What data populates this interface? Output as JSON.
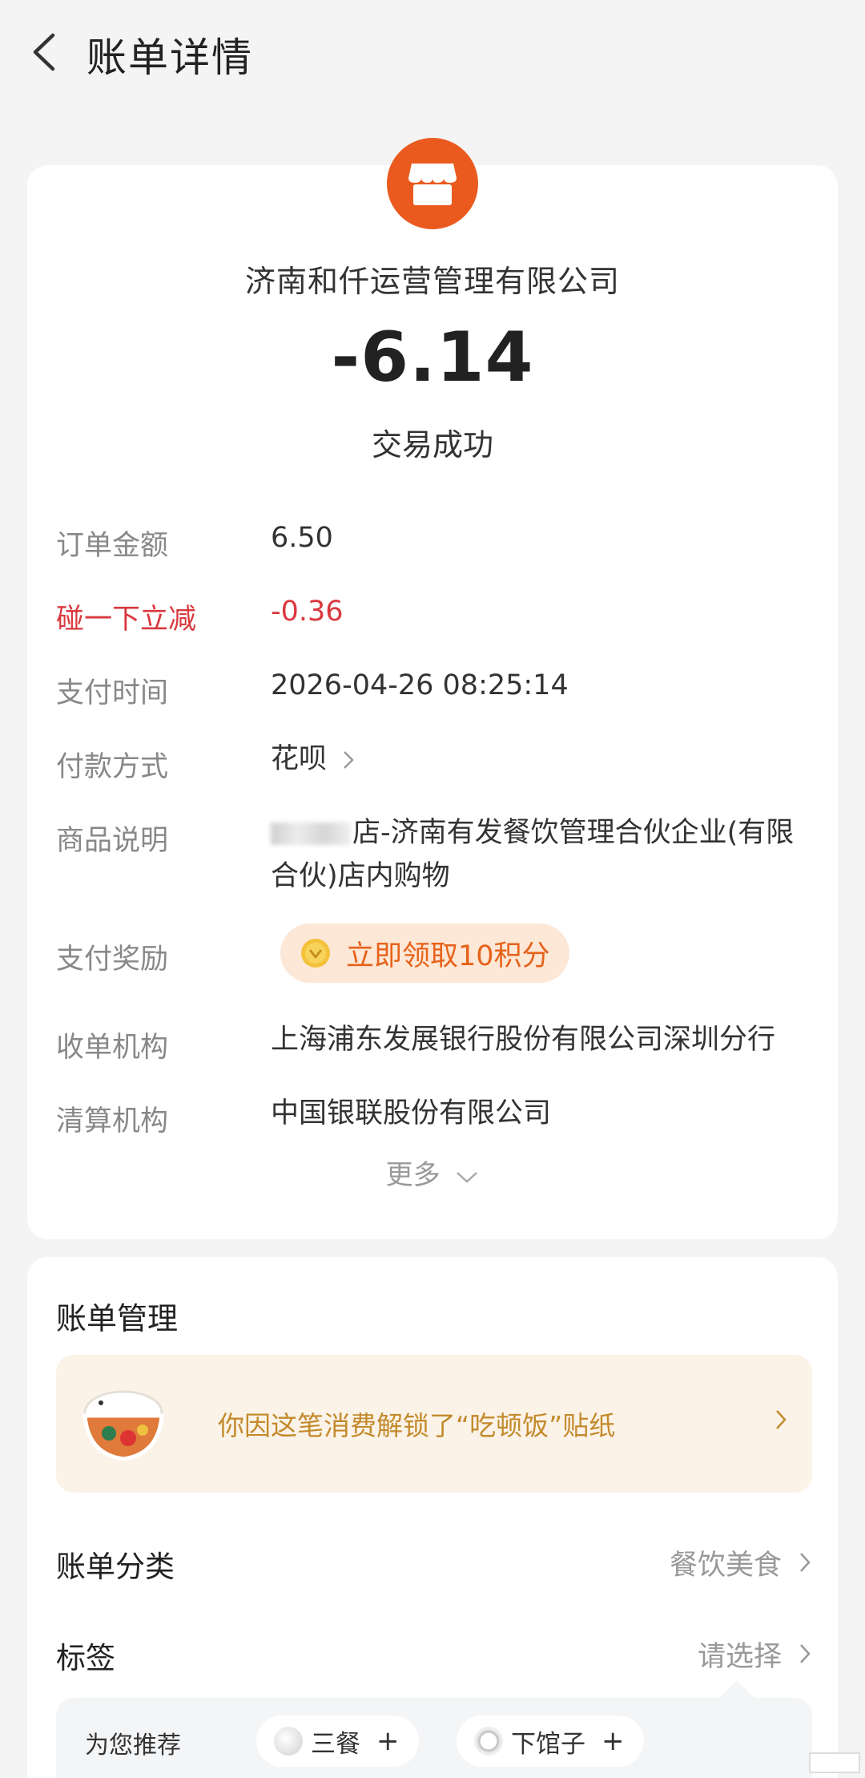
{
  "header": {
    "title": "账单详情"
  },
  "transaction": {
    "merchant_icon": "shop-icon",
    "merchant_name": "济南和仟运营管理有限公司",
    "amount": "-6.14",
    "status": "交易成功"
  },
  "details": {
    "order_amount": {
      "label": "订单金额",
      "value": "6.50"
    },
    "discount": {
      "label": "碰一下立减",
      "value": "-0.36"
    },
    "pay_time": {
      "label": "支付时间",
      "value": "2026-04-26 08:25:14"
    },
    "pay_method": {
      "label": "付款方式",
      "value": "花呗"
    },
    "description": {
      "label": "商品说明",
      "value": "店-济南有发餐饮管理合伙企业(有限合伙)店内购物"
    },
    "reward": {
      "label": "支付奖励",
      "value": "立即领取10积分"
    },
    "acquirer": {
      "label": "收单机构",
      "value": "上海浦东发展银行股份有限公司深圳分行"
    },
    "clearing": {
      "label": "清算机构",
      "value": "中国银联股份有限公司"
    },
    "more": "更多"
  },
  "manage": {
    "title": "账单管理",
    "sticker_text": "你因这笔消费解锁了“吃顿饭”贴纸",
    "category": {
      "label": "账单分类",
      "value": "餐饮美食"
    },
    "tags": {
      "label": "标签",
      "value": "请选择"
    },
    "recommend": {
      "label": "为您推荐",
      "chips": [
        {
          "name": "三餐",
          "plus": "+"
        },
        {
          "name": "下馆子",
          "plus": "+"
        }
      ]
    }
  },
  "colors": {
    "accent": "#ea5a1f",
    "discount_red": "#d9383e",
    "reward_orange": "#e6621a",
    "sticker_gold": "#c38a2c"
  }
}
